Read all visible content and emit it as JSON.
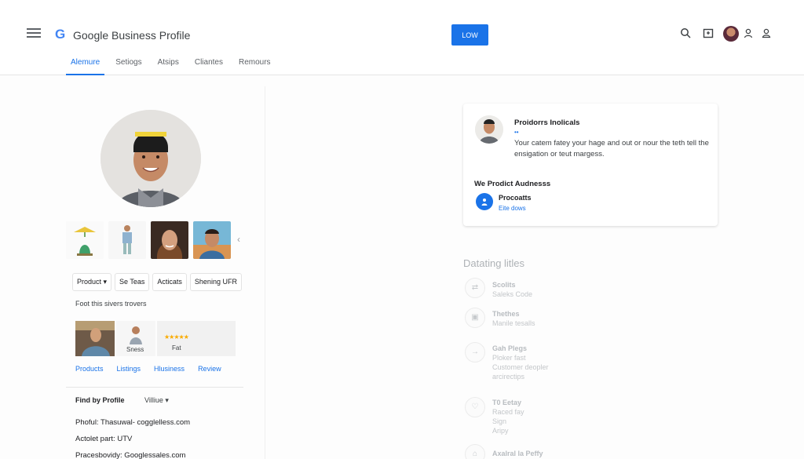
{
  "header": {
    "app_title": "Google Business Profile",
    "logo_letter": "G",
    "cta_label": "LOW"
  },
  "tabs": [
    {
      "label": "Alemure"
    },
    {
      "label": "Setiogs"
    },
    {
      "label": "Atsips"
    },
    {
      "label": "Cliantes"
    },
    {
      "label": "Remours"
    }
  ],
  "left": {
    "chips": [
      "Product ▾",
      "Se Teas",
      "Acticats",
      "Shening UFR"
    ],
    "note": "Foot this sivers trovers",
    "cards": {
      "person_label": "Sness",
      "rating_label": "Fat",
      "stars": "★★★★★"
    },
    "links": [
      "Products",
      "Listings",
      "Hlusiness",
      "Review"
    ],
    "find_label": "Find by Profile",
    "find_select": "Villiue ▾",
    "info_lines": [
      "Phoful: Thasuwal- cogglelless.com",
      "Actolet part: UTV",
      "Pracesbovidy: Googlessales.com"
    ]
  },
  "info_card": {
    "title": "Proidorrs Inolicals",
    "dots": "••",
    "description": "Your catem fatey your hage and out or nour the teth tell the ensigation or teut margess.",
    "subheading": "We Prodict Audnesss",
    "row_title": "Procoatts",
    "row_link": "Eite dows",
    "badge_icon": "person-icon"
  },
  "faded": {
    "title": "Datating litles",
    "items": [
      {
        "icon": "link-icon",
        "glyph": "⇄",
        "title": "Scolits",
        "lines": [
          "Saleks Code"
        ]
      },
      {
        "icon": "image-icon",
        "glyph": "▣",
        "title": "Thethes",
        "lines": [
          "Manile tesalls"
        ]
      },
      {
        "icon": "arrow-icon",
        "glyph": "→",
        "title": "Gah Plegs",
        "lines": [
          "Ploker fast",
          "Customer deopler",
          "arcirectips"
        ]
      },
      {
        "icon": "heart-icon",
        "glyph": "♡",
        "title": "T0 Eetay",
        "lines": [
          "Raced fay",
          "Sign",
          "Aripy"
        ]
      },
      {
        "icon": "bag-icon",
        "glyph": "⌂",
        "title": "Axalral la Peffy",
        "lines": []
      }
    ]
  },
  "colors": {
    "accent": "#1a73e8",
    "star": "#f9ab00"
  }
}
